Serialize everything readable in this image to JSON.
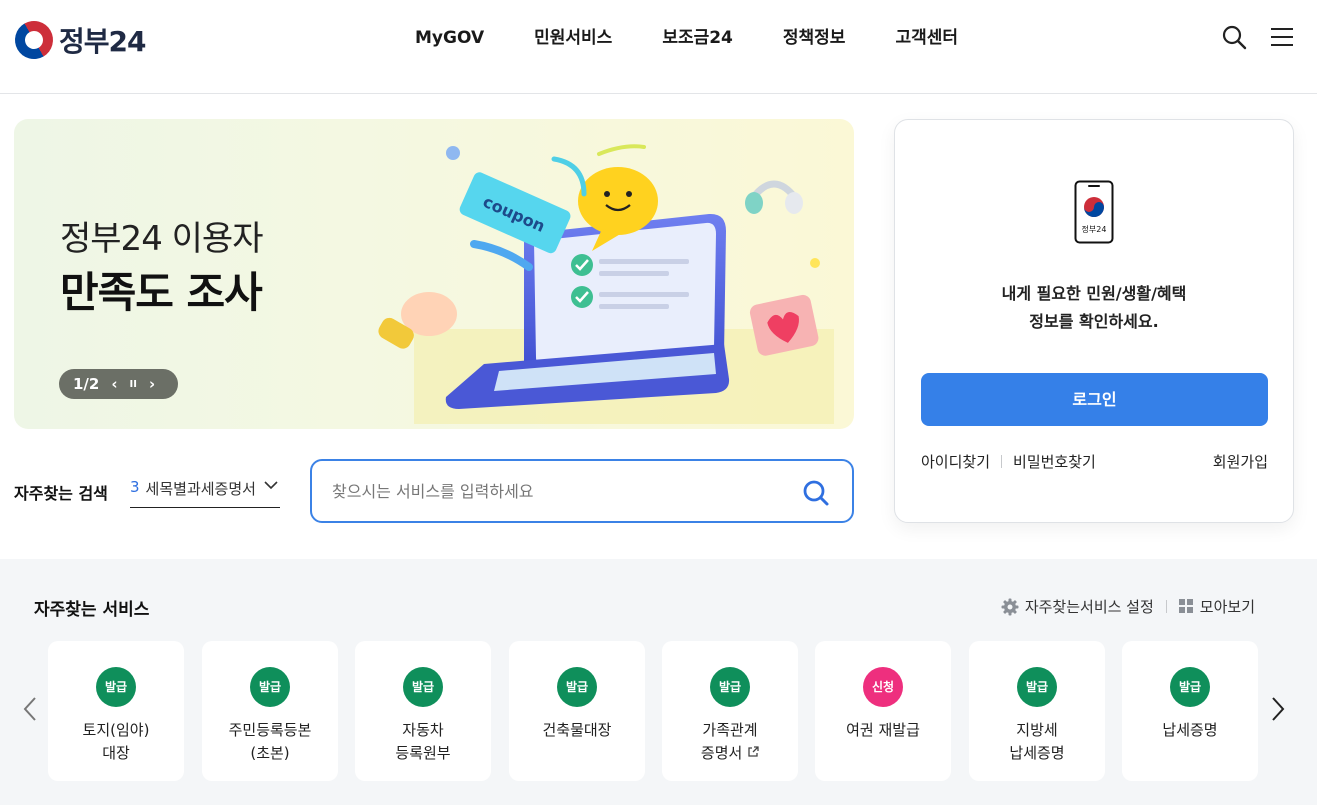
{
  "header": {
    "logo_text": "정부24",
    "nav": [
      "MyGOV",
      "민원서비스",
      "보조금24",
      "정책정보",
      "고객센터"
    ],
    "search_icon": "search-icon",
    "menu_icon": "hamburger-menu-icon"
  },
  "banner": {
    "subtitle": "정부24 이용자",
    "title": "만족도 조사",
    "pager": "1/2",
    "prev": "‹",
    "pause": "II",
    "next": "›",
    "coupon_text": "coupon"
  },
  "search": {
    "label": "자주찾는 검색",
    "rank": "3",
    "selected_keyword": "세목별과세증명서",
    "placeholder": "찾으시는 서비스를 입력하세요"
  },
  "login": {
    "phone_label": "정부24",
    "message_line1": "내게 필요한 민원/생활/혜택",
    "message_line2": "정보를 확인하세요.",
    "button": "로그인",
    "find_id": "아이디찾기",
    "find_pw": "비밀번호찾기",
    "join": "회원가입"
  },
  "services": {
    "title": "자주찾는 서비스",
    "settings": "자주찾는서비스 설정",
    "view_all": "모아보기",
    "items": [
      {
        "badge": "발급",
        "line1": "토지(임야)",
        "line2": "대장"
      },
      {
        "badge": "발급",
        "line1": "주민등록등본",
        "line2": "(초본)"
      },
      {
        "badge": "발급",
        "line1": "자동차",
        "line2": "등록원부"
      },
      {
        "badge": "발급",
        "line1": "건축물대장",
        "line2": ""
      },
      {
        "badge": "발급",
        "line1": "가족관계",
        "line2": "증명서"
      },
      {
        "badge": "신청",
        "line1": "여권 재발급",
        "line2": ""
      },
      {
        "badge": "발급",
        "line1": "지방세",
        "line2": "납세증명"
      },
      {
        "badge": "발급",
        "line1": "납세증명",
        "line2": ""
      }
    ]
  },
  "colors": {
    "primary": "#3580e8",
    "badge_issue": "#0f8f5b",
    "badge_apply": "#ee2f7e",
    "section_bg": "#f4f6f8"
  }
}
